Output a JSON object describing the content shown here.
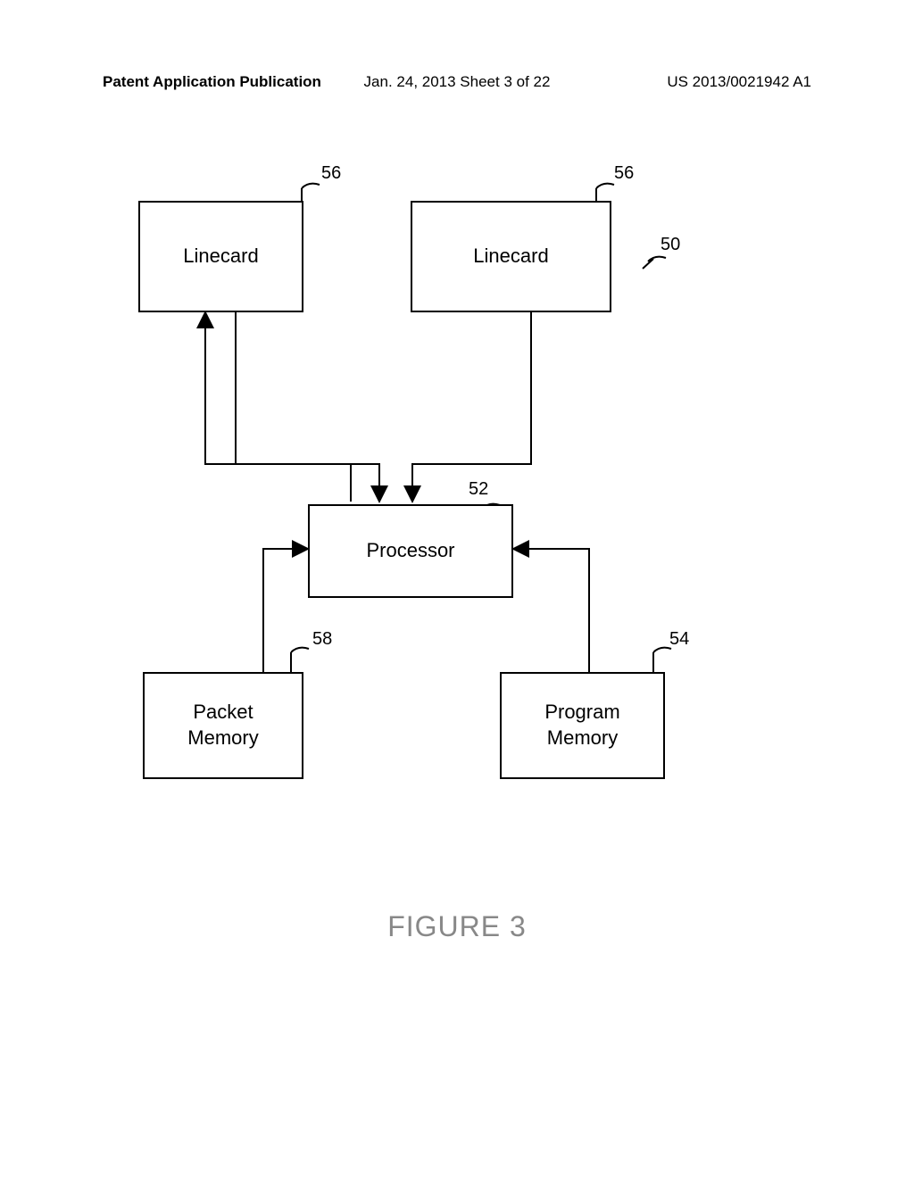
{
  "header": {
    "left": "Patent Application Publication",
    "center": "Jan. 24, 2013  Sheet 3 of 22",
    "right": "US 2013/0021942 A1"
  },
  "boxes": {
    "linecard1": "Linecard",
    "linecard2": "Linecard",
    "processor": "Processor",
    "packet_memory": "Packet\nMemory",
    "program_memory": "Program\nMemory"
  },
  "refs": {
    "r56a": "56",
    "r56b": "56",
    "r50": "50",
    "r52": "52",
    "r58": "58",
    "r54": "54"
  },
  "figure_label": "FIGURE 3"
}
